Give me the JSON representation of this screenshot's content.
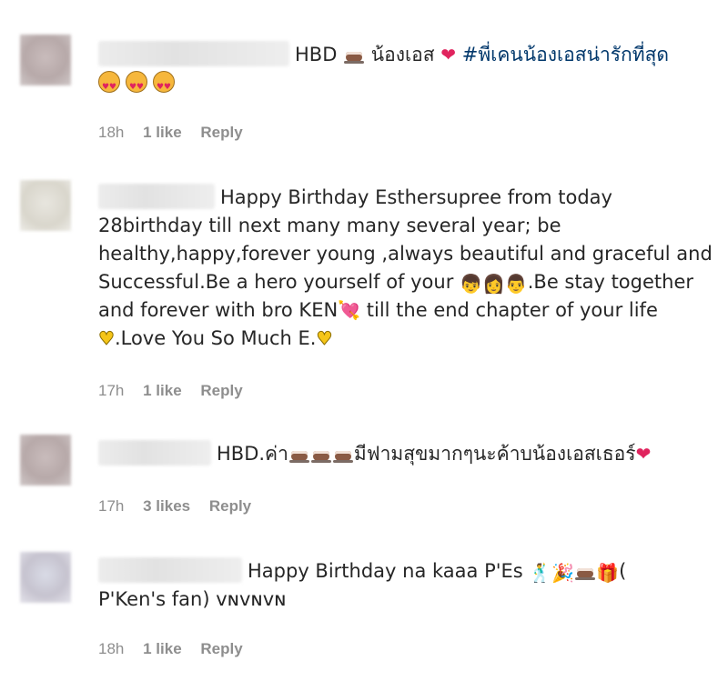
{
  "comments": [
    {
      "text_parts": {
        "prefix": "HBD",
        "name": "น้องเอส",
        "hashtag": "#พี่เคนน้องเอสน่ารักที่สุด"
      },
      "time": "18h",
      "likes": "1 like",
      "reply": "Reply"
    },
    {
      "text": "Happy Birthday Esthersupree from today 28birthday till next many many several year; be healthy,happy,forever young ,always beautiful and graceful and Successful.Be a hero yourself of your",
      "text_part2": ".Be stay together and forever with bro KEN",
      "text_part3": " till the end chapter of your life",
      "text_part4": ".Love You So Much E.",
      "time": "17h",
      "likes": "1 like",
      "reply": "Reply"
    },
    {
      "text_prefix": "HBD.ค่า",
      "text_suffix": "มีฟามสุขมากๆนะค้าบน้องเอสเธอร์",
      "time": "17h",
      "likes": "3 likes",
      "reply": "Reply"
    },
    {
      "text": "Happy Birthday na kaaa P'Es",
      "text_tail": "(",
      "text_line2": "P'Ken's fan) ᴠɴᴠɴᴠɴ",
      "time": "18h",
      "likes": "1 like",
      "reply": "Reply"
    }
  ],
  "colors": {
    "text": "#262626",
    "meta": "#8e8e8e",
    "hashtag": "#00376b",
    "heart": "#e0245e"
  }
}
